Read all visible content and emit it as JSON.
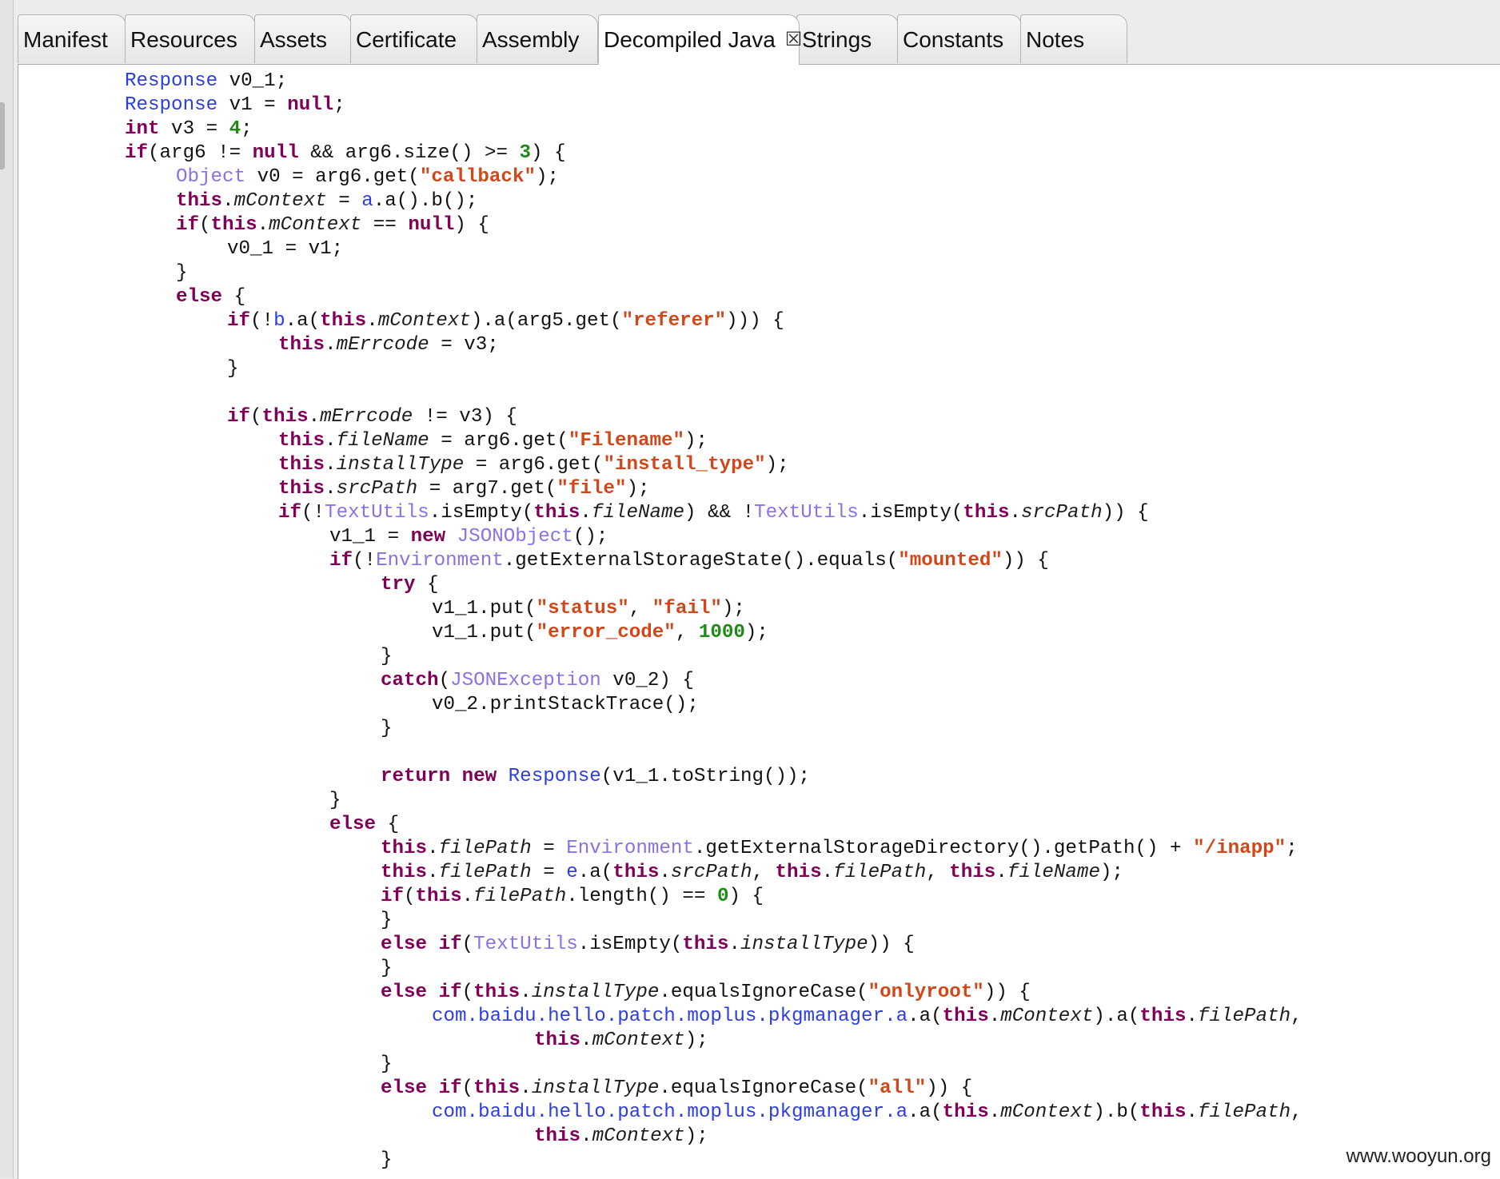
{
  "tabs": [
    {
      "label": "Manifest",
      "active": false
    },
    {
      "label": "Resources",
      "active": false
    },
    {
      "label": "Assets",
      "active": false
    },
    {
      "label": "Certificate",
      "active": false
    },
    {
      "label": "Assembly",
      "active": false
    },
    {
      "label": "Decompiled Java",
      "active": true,
      "closable": true
    },
    {
      "label": "Strings",
      "active": false
    },
    {
      "label": "Constants",
      "active": false
    },
    {
      "label": "Notes",
      "active": false
    }
  ],
  "colors": {
    "keyword": "#7f0055",
    "type": "#2d3ee0",
    "external_type": "#8b71e8",
    "string": "#d2471a",
    "number": "#1f8a16"
  },
  "code_lines": [
    [
      [
        2,
        ""
      ],
      [
        "ty",
        "Response"
      ],
      [
        "pl",
        " v0_1;"
      ]
    ],
    [
      [
        2,
        ""
      ],
      [
        "ty",
        "Response"
      ],
      [
        "pl",
        " v1 = "
      ],
      [
        "kw",
        "null"
      ],
      [
        "pl",
        ";"
      ]
    ],
    [
      [
        2,
        ""
      ],
      [
        "kw",
        "int"
      ],
      [
        "pl",
        " v3 = "
      ],
      [
        "nm",
        "4"
      ],
      [
        "pl",
        ";"
      ]
    ],
    [
      [
        2,
        ""
      ],
      [
        "kw",
        "if"
      ],
      [
        "pl",
        "(arg6 != "
      ],
      [
        "kw",
        "null"
      ],
      [
        "pl",
        " && arg6.size() >= "
      ],
      [
        "nm",
        "3"
      ],
      [
        "pl",
        ") {"
      ]
    ],
    [
      [
        3,
        ""
      ],
      [
        "ex",
        "Object"
      ],
      [
        "pl",
        " v0 = arg6.get("
      ],
      [
        "st",
        "\"callback\""
      ],
      [
        "pl",
        ");"
      ]
    ],
    [
      [
        3,
        ""
      ],
      [
        "kw",
        "this"
      ],
      [
        "pl",
        "."
      ],
      [
        "fd",
        "mContext"
      ],
      [
        "pl",
        " = "
      ],
      [
        "ty",
        "a"
      ],
      [
        "pl",
        ".a().b();"
      ]
    ],
    [
      [
        3,
        ""
      ],
      [
        "kw",
        "if"
      ],
      [
        "pl",
        "("
      ],
      [
        "kw",
        "this"
      ],
      [
        "pl",
        "."
      ],
      [
        "fd",
        "mContext"
      ],
      [
        "pl",
        " == "
      ],
      [
        "kw",
        "null"
      ],
      [
        "pl",
        ") {"
      ]
    ],
    [
      [
        4,
        ""
      ],
      [
        "pl",
        "v0_1 = v1;"
      ]
    ],
    [
      [
        3,
        ""
      ],
      [
        "pl",
        "}"
      ]
    ],
    [
      [
        3,
        ""
      ],
      [
        "kw",
        "else"
      ],
      [
        "pl",
        " {"
      ]
    ],
    [
      [
        4,
        ""
      ],
      [
        "kw",
        "if"
      ],
      [
        "pl",
        "(!"
      ],
      [
        "ty",
        "b"
      ],
      [
        "pl",
        ".a("
      ],
      [
        "kw",
        "this"
      ],
      [
        "pl",
        "."
      ],
      [
        "fd",
        "mContext"
      ],
      [
        "pl",
        ").a(arg5.get("
      ],
      [
        "st",
        "\"referer\""
      ],
      [
        "pl",
        "))) {"
      ]
    ],
    [
      [
        5,
        ""
      ],
      [
        "kw",
        "this"
      ],
      [
        "pl",
        "."
      ],
      [
        "fd",
        "mErrcode"
      ],
      [
        "pl",
        " = v3;"
      ]
    ],
    [
      [
        4,
        ""
      ],
      [
        "pl",
        "}"
      ]
    ],
    [
      [
        0,
        ""
      ]
    ],
    [
      [
        4,
        ""
      ],
      [
        "kw",
        "if"
      ],
      [
        "pl",
        "("
      ],
      [
        "kw",
        "this"
      ],
      [
        "pl",
        "."
      ],
      [
        "fd",
        "mErrcode"
      ],
      [
        "pl",
        " != v3) {"
      ]
    ],
    [
      [
        5,
        ""
      ],
      [
        "kw",
        "this"
      ],
      [
        "pl",
        "."
      ],
      [
        "fd",
        "fileName"
      ],
      [
        "pl",
        " = arg6.get("
      ],
      [
        "st",
        "\"Filename\""
      ],
      [
        "pl",
        ");"
      ]
    ],
    [
      [
        5,
        ""
      ],
      [
        "kw",
        "this"
      ],
      [
        "pl",
        "."
      ],
      [
        "fd",
        "installType"
      ],
      [
        "pl",
        " = arg6.get("
      ],
      [
        "st",
        "\"install_type\""
      ],
      [
        "pl",
        ");"
      ]
    ],
    [
      [
        5,
        ""
      ],
      [
        "kw",
        "this"
      ],
      [
        "pl",
        "."
      ],
      [
        "fd",
        "srcPath"
      ],
      [
        "pl",
        " = arg7.get("
      ],
      [
        "st",
        "\"file\""
      ],
      [
        "pl",
        ");"
      ]
    ],
    [
      [
        5,
        ""
      ],
      [
        "kw",
        "if"
      ],
      [
        "pl",
        "(!"
      ],
      [
        "ex",
        "TextUtils"
      ],
      [
        "pl",
        ".isEmpty("
      ],
      [
        "kw",
        "this"
      ],
      [
        "pl",
        "."
      ],
      [
        "fd",
        "fileName"
      ],
      [
        "pl",
        ") && !"
      ],
      [
        "ex",
        "TextUtils"
      ],
      [
        "pl",
        ".isEmpty("
      ],
      [
        "kw",
        "this"
      ],
      [
        "pl",
        "."
      ],
      [
        "fd",
        "srcPath"
      ],
      [
        "pl",
        ")) {"
      ]
    ],
    [
      [
        6,
        ""
      ],
      [
        "pl",
        "v1_1 = "
      ],
      [
        "kw",
        "new"
      ],
      [
        "pl",
        " "
      ],
      [
        "ex",
        "JSONObject"
      ],
      [
        "pl",
        "();"
      ]
    ],
    [
      [
        6,
        ""
      ],
      [
        "kw",
        "if"
      ],
      [
        "pl",
        "(!"
      ],
      [
        "ex",
        "Environment"
      ],
      [
        "pl",
        ".getExternalStorageState().equals("
      ],
      [
        "st",
        "\"mounted\""
      ],
      [
        "pl",
        ")) {"
      ]
    ],
    [
      [
        7,
        ""
      ],
      [
        "kw",
        "try"
      ],
      [
        "pl",
        " {"
      ]
    ],
    [
      [
        8,
        ""
      ],
      [
        "pl",
        "v1_1.put("
      ],
      [
        "st",
        "\"status\""
      ],
      [
        "pl",
        ", "
      ],
      [
        "st",
        "\"fail\""
      ],
      [
        "pl",
        ");"
      ]
    ],
    [
      [
        8,
        ""
      ],
      [
        "pl",
        "v1_1.put("
      ],
      [
        "st",
        "\"error_code\""
      ],
      [
        "pl",
        ", "
      ],
      [
        "nm",
        "1000"
      ],
      [
        "pl",
        ");"
      ]
    ],
    [
      [
        7,
        ""
      ],
      [
        "pl",
        "}"
      ]
    ],
    [
      [
        7,
        ""
      ],
      [
        "kw",
        "catch"
      ],
      [
        "pl",
        "("
      ],
      [
        "ex",
        "JSONException"
      ],
      [
        "pl",
        " v0_2) {"
      ]
    ],
    [
      [
        8,
        ""
      ],
      [
        "pl",
        "v0_2.printStackTrace();"
      ]
    ],
    [
      [
        7,
        ""
      ],
      [
        "pl",
        "}"
      ]
    ],
    [
      [
        0,
        ""
      ]
    ],
    [
      [
        7,
        ""
      ],
      [
        "kw",
        "return"
      ],
      [
        "pl",
        " "
      ],
      [
        "kw",
        "new"
      ],
      [
        "pl",
        " "
      ],
      [
        "ty",
        "Response"
      ],
      [
        "pl",
        "(v1_1.toString());"
      ]
    ],
    [
      [
        6,
        ""
      ],
      [
        "pl",
        "}"
      ]
    ],
    [
      [
        6,
        ""
      ],
      [
        "kw",
        "else"
      ],
      [
        "pl",
        " {"
      ]
    ],
    [
      [
        7,
        ""
      ],
      [
        "kw",
        "this"
      ],
      [
        "pl",
        "."
      ],
      [
        "fd",
        "filePath"
      ],
      [
        "pl",
        " = "
      ],
      [
        "ex",
        "Environment"
      ],
      [
        "pl",
        ".getExternalStorageDirectory().getPath() + "
      ],
      [
        "st",
        "\"/inapp\""
      ],
      [
        "pl",
        ";"
      ]
    ],
    [
      [
        7,
        ""
      ],
      [
        "kw",
        "this"
      ],
      [
        "pl",
        "."
      ],
      [
        "fd",
        "filePath"
      ],
      [
        "pl",
        " = "
      ],
      [
        "ty",
        "e"
      ],
      [
        "pl",
        ".a("
      ],
      [
        "kw",
        "this"
      ],
      [
        "pl",
        "."
      ],
      [
        "fd",
        "srcPath"
      ],
      [
        "pl",
        ", "
      ],
      [
        "kw",
        "this"
      ],
      [
        "pl",
        "."
      ],
      [
        "fd",
        "filePath"
      ],
      [
        "pl",
        ", "
      ],
      [
        "kw",
        "this"
      ],
      [
        "pl",
        "."
      ],
      [
        "fd",
        "fileName"
      ],
      [
        "pl",
        ");"
      ]
    ],
    [
      [
        7,
        ""
      ],
      [
        "kw",
        "if"
      ],
      [
        "pl",
        "("
      ],
      [
        "kw",
        "this"
      ],
      [
        "pl",
        "."
      ],
      [
        "fd",
        "filePath"
      ],
      [
        "pl",
        ".length() == "
      ],
      [
        "nm",
        "0"
      ],
      [
        "pl",
        ") {"
      ]
    ],
    [
      [
        7,
        ""
      ],
      [
        "pl",
        "}"
      ]
    ],
    [
      [
        7,
        ""
      ],
      [
        "kw",
        "else"
      ],
      [
        "pl",
        " "
      ],
      [
        "kw",
        "if"
      ],
      [
        "pl",
        "("
      ],
      [
        "ex",
        "TextUtils"
      ],
      [
        "pl",
        ".isEmpty("
      ],
      [
        "kw",
        "this"
      ],
      [
        "pl",
        "."
      ],
      [
        "fd",
        "installType"
      ],
      [
        "pl",
        ")) {"
      ]
    ],
    [
      [
        7,
        ""
      ],
      [
        "pl",
        "}"
      ]
    ],
    [
      [
        7,
        ""
      ],
      [
        "kw",
        "else"
      ],
      [
        "pl",
        " "
      ],
      [
        "kw",
        "if"
      ],
      [
        "pl",
        "("
      ],
      [
        "kw",
        "this"
      ],
      [
        "pl",
        "."
      ],
      [
        "fd",
        "installType"
      ],
      [
        "pl",
        ".equalsIgnoreCase("
      ],
      [
        "st",
        "\"onlyroot\""
      ],
      [
        "pl",
        ")) {"
      ]
    ],
    [
      [
        8,
        ""
      ],
      [
        "ty",
        "com.baidu.hello.patch.moplus.pkgmanager.a"
      ],
      [
        "pl",
        ".a("
      ],
      [
        "kw",
        "this"
      ],
      [
        "pl",
        "."
      ],
      [
        "fd",
        "mContext"
      ],
      [
        "pl",
        ").a("
      ],
      [
        "kw",
        "this"
      ],
      [
        "pl",
        "."
      ],
      [
        "fd",
        "filePath"
      ],
      [
        "pl",
        ","
      ]
    ],
    [
      [
        10,
        ""
      ],
      [
        "kw",
        "this"
      ],
      [
        "pl",
        "."
      ],
      [
        "fd",
        "mContext"
      ],
      [
        "pl",
        ");"
      ]
    ],
    [
      [
        7,
        ""
      ],
      [
        "pl",
        "}"
      ]
    ],
    [
      [
        7,
        ""
      ],
      [
        "kw",
        "else"
      ],
      [
        "pl",
        " "
      ],
      [
        "kw",
        "if"
      ],
      [
        "pl",
        "("
      ],
      [
        "kw",
        "this"
      ],
      [
        "pl",
        "."
      ],
      [
        "fd",
        "installType"
      ],
      [
        "pl",
        ".equalsIgnoreCase("
      ],
      [
        "st",
        "\"all\""
      ],
      [
        "pl",
        ")) {"
      ]
    ],
    [
      [
        8,
        ""
      ],
      [
        "ty",
        "com.baidu.hello.patch.moplus.pkgmanager.a"
      ],
      [
        "pl",
        ".a("
      ],
      [
        "kw",
        "this"
      ],
      [
        "pl",
        "."
      ],
      [
        "fd",
        "mContext"
      ],
      [
        "pl",
        ").b("
      ],
      [
        "kw",
        "this"
      ],
      [
        "pl",
        "."
      ],
      [
        "fd",
        "filePath"
      ],
      [
        "pl",
        ","
      ]
    ],
    [
      [
        10,
        ""
      ],
      [
        "kw",
        "this"
      ],
      [
        "pl",
        "."
      ],
      [
        "fd",
        "mContext"
      ],
      [
        "pl",
        ");"
      ]
    ],
    [
      [
        7,
        ""
      ],
      [
        "pl",
        "}"
      ]
    ]
  ],
  "watermark": "www.wooyun.org"
}
